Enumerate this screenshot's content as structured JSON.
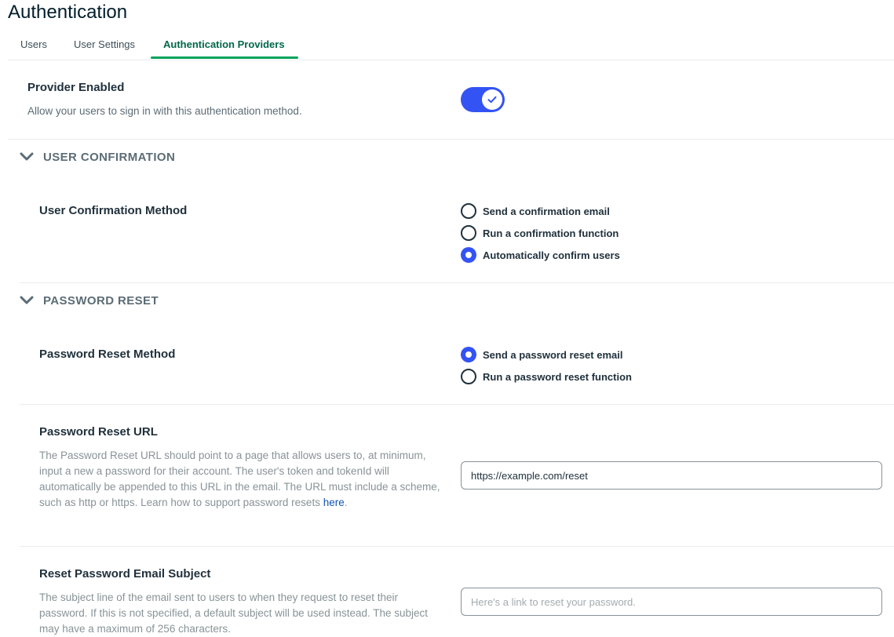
{
  "page": {
    "title": "Authentication"
  },
  "tabs": [
    {
      "label": "Users"
    },
    {
      "label": "User Settings"
    },
    {
      "label": "Authentication Providers",
      "active": true
    }
  ],
  "provider": {
    "title": "Provider Enabled",
    "description": "Allow your users to sign in with this authentication method.",
    "enabled": true
  },
  "sections": {
    "user_confirmation": {
      "header": "USER CONFIRMATION",
      "method_label": "User Confirmation Method",
      "options": [
        {
          "label": "Send a confirmation email",
          "checked": false
        },
        {
          "label": "Run a confirmation function",
          "checked": false
        },
        {
          "label": "Automatically confirm users",
          "checked": true
        }
      ]
    },
    "password_reset": {
      "header": "PASSWORD RESET",
      "method_label": "Password Reset Method",
      "options": [
        {
          "label": "Send a password reset email",
          "checked": true
        },
        {
          "label": "Run a password reset function",
          "checked": false
        }
      ],
      "url": {
        "label": "Password Reset URL",
        "help": "The Password Reset URL should point to a page that allows users to, at minimum, input a new a password for their account. The user's token and tokenId will automatically be appended to this URL in the email. The URL must include a scheme, such as http or https. Learn how to support password resets",
        "help_link": "here",
        "value": "https://example.com/reset"
      },
      "subject": {
        "label": "Reset Password Email Subject",
        "help": "The subject line of the email sent to users to when they request to reset their password. If this is not specified, a default subject will be used instead. The subject may have a maximum of 256 characters.",
        "placeholder": "Here's a link to reset your password."
      }
    }
  },
  "colors": {
    "accent": "#3353f4",
    "tab_active": "#00684a",
    "tab_underline": "#00a35c",
    "link": "#1254b7"
  }
}
